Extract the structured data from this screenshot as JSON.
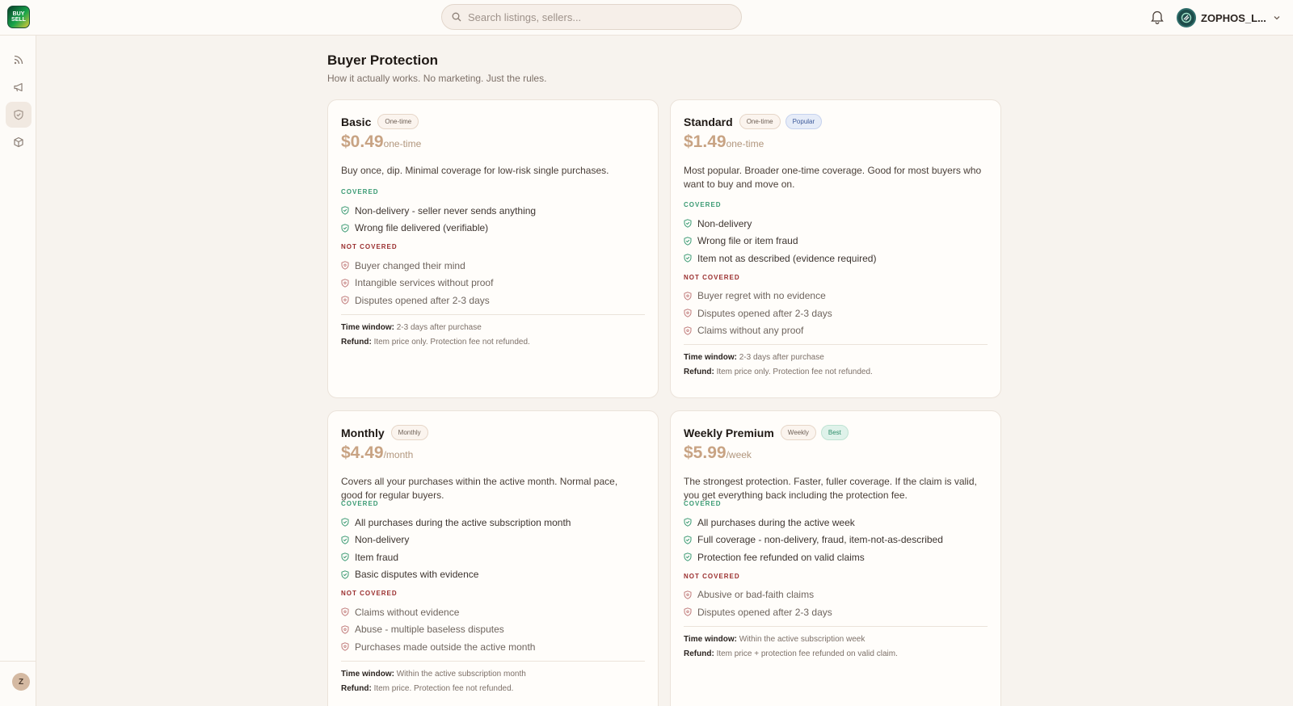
{
  "app": {
    "logo_text": "BUY SELL"
  },
  "search": {
    "placeholder": "Search listings, sellers..."
  },
  "user": {
    "name": "ZOPHOS_L...",
    "avatar_initial": "Z"
  },
  "page": {
    "title": "Buyer Protection",
    "subtitle": "How it actually works. No marketing. Just the rules."
  },
  "labels": {
    "covered": "COVERED",
    "not_covered": "NOT COVERED",
    "time_window": "Time window:",
    "refund": "Refund:"
  },
  "plans": [
    {
      "name": "Basic",
      "badges": [
        "One-time"
      ],
      "price": "$0.49",
      "unit": "one-time",
      "description": "Buy once, dip. Minimal coverage for low-risk single purchases.",
      "covered": [
        "Non-delivery - seller never sends anything",
        "Wrong file delivered (verifiable)"
      ],
      "not_covered": [
        "Buyer changed their mind",
        "Intangible services without proof",
        "Disputes opened after 2-3 days"
      ],
      "time_window": "2-3 days after purchase",
      "refund": "Item price only. Protection fee not refunded."
    },
    {
      "name": "Standard",
      "badges": [
        "One-time",
        "Popular"
      ],
      "price": "$1.49",
      "unit": "one-time",
      "description": "Most popular. Broader one-time coverage. Good for most buyers who want to buy and move on.",
      "covered": [
        "Non-delivery",
        "Wrong file or item fraud",
        "Item not as described (evidence required)"
      ],
      "not_covered": [
        "Buyer regret with no evidence",
        "Disputes opened after 2-3 days",
        "Claims without any proof"
      ],
      "time_window": "2-3 days after purchase",
      "refund": "Item price only. Protection fee not refunded."
    },
    {
      "name": "Monthly",
      "badges": [
        "Monthly"
      ],
      "price": "$4.49",
      "unit": "/month",
      "description": "Covers all your purchases within the active month. Normal pace, good for regular buyers.",
      "covered": [
        "All purchases during the active subscription month",
        "Non-delivery",
        "Item fraud",
        "Basic disputes with evidence"
      ],
      "not_covered": [
        "Claims without evidence",
        "Abuse - multiple baseless disputes",
        "Purchases made outside the active month"
      ],
      "time_window": "Within the active subscription month",
      "refund": "Item price. Protection fee not refunded."
    },
    {
      "name": "Weekly Premium",
      "badges": [
        "Weekly",
        "Best"
      ],
      "price": "$5.99",
      "unit": "/week",
      "description": "The strongest protection. Faster, fuller coverage. If the claim is valid, you get everything back including the protection fee.",
      "covered": [
        "All purchases during the active week",
        "Full coverage - non-delivery, fraud, item-not-as-described",
        "Protection fee refunded on valid claims"
      ],
      "not_covered": [
        "Abusive or bad-faith claims",
        "Disputes opened after 2-3 days"
      ],
      "time_window": "Within the active subscription week",
      "refund": "Item price + protection fee refunded on valid claim."
    }
  ]
}
